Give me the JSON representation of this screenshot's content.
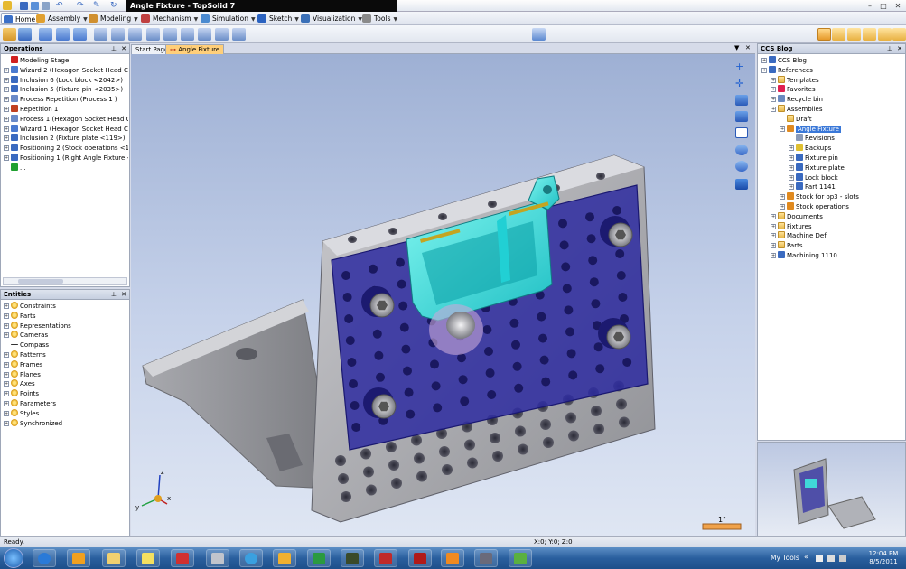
{
  "window": {
    "title": "Angle Fixture - TopSolid 7"
  },
  "menus": [
    {
      "label": "Home",
      "color": "#3a6fc8"
    },
    {
      "label": "Assembly",
      "color": "#e0a030"
    },
    {
      "label": "Modeling",
      "color": "#d09030"
    },
    {
      "label": "Mechanism",
      "color": "#c04040"
    },
    {
      "label": "Simulation",
      "color": "#4a8ad0"
    },
    {
      "label": "Sketch",
      "color": "#2a62c0"
    },
    {
      "label": "Visualization",
      "color": "#3a70b8"
    },
    {
      "label": "Tools",
      "color": "#8a8a8a"
    }
  ],
  "operations": {
    "title": "Operations",
    "items": [
      {
        "label": "Modeling Stage",
        "icon": "red-arrow-icon"
      },
      {
        "label": "Wizard 2 (Hexagon Socket Head Cap",
        "icon": "wizard-icon"
      },
      {
        "label": "Inclusion 6 (Lock block <2042>)",
        "icon": "inclusion-icon"
      },
      {
        "label": "Inclusion 5 (Fixture pin <2035>)",
        "icon": "inclusion-icon"
      },
      {
        "label": "Process Repetition (Process 1 )",
        "icon": "process-icon"
      },
      {
        "label": "Repetition 1",
        "icon": "repetition-icon"
      },
      {
        "label": "Process 1 (Hexagon Socket Head Cap",
        "icon": "process-icon"
      },
      {
        "label": "Wizard 1 (Hexagon Socket Head Cap",
        "icon": "wizard-icon"
      },
      {
        "label": "Inclusion 2 (Fixture plate <119>)",
        "icon": "inclusion-icon"
      },
      {
        "label": "Positioning 2 (Stock operations <126",
        "icon": "positioning-icon"
      },
      {
        "label": "Positioning 1 (Right Angle Fixture <1",
        "icon": "positioning-icon"
      },
      {
        "label": "...",
        "icon": "green-arrow-icon"
      }
    ]
  },
  "entities": {
    "title": "Entities",
    "items": [
      "Constraints",
      "Parts",
      "Representations",
      "Cameras",
      "Compass",
      "Patterns",
      "Frames",
      "Planes",
      "Axes",
      "Points",
      "Parameters",
      "Styles",
      "Synchronized"
    ]
  },
  "tabs": [
    {
      "label": "Start Page"
    },
    {
      "label": "Angle Fixture"
    }
  ],
  "ccs": {
    "title": "CCS Blog",
    "items": [
      {
        "label": "CCS Blog",
        "level": 0,
        "icon": "blog-icon"
      },
      {
        "label": "References",
        "level": 0,
        "icon": "references-icon"
      },
      {
        "label": "Templates",
        "level": 1,
        "icon": "folder-icon"
      },
      {
        "label": "Favorites",
        "level": 1,
        "icon": "favorites-icon"
      },
      {
        "label": "Recycle bin",
        "level": 1,
        "icon": "recycle-bin-icon"
      },
      {
        "label": "Assemblies",
        "level": 1,
        "icon": "folder-icon"
      },
      {
        "label": "Draft",
        "level": 2,
        "icon": "folder-icon"
      },
      {
        "label": "Angle Fixture",
        "level": 2,
        "icon": "assembly-icon",
        "selected": true
      },
      {
        "label": "Revisions",
        "level": 3,
        "icon": "revisions-icon"
      },
      {
        "label": "Backups",
        "level": 3,
        "icon": "backups-icon"
      },
      {
        "label": "Fixture pin",
        "level": 3,
        "icon": "part-icon"
      },
      {
        "label": "Fixture plate",
        "level": 3,
        "icon": "part-icon"
      },
      {
        "label": "Lock block",
        "level": 3,
        "icon": "part-icon"
      },
      {
        "label": "Part 1141",
        "level": 3,
        "icon": "part-icon"
      },
      {
        "label": "Stock for op3 - slots",
        "level": 2,
        "icon": "stock-icon"
      },
      {
        "label": "Stock operations",
        "level": 2,
        "icon": "stock-icon"
      },
      {
        "label": "Documents",
        "level": 1,
        "icon": "folder-icon"
      },
      {
        "label": "Fixtures",
        "level": 1,
        "icon": "folder-icon"
      },
      {
        "label": "Machine Def",
        "level": 1,
        "icon": "folder-icon"
      },
      {
        "label": "Parts",
        "level": 1,
        "icon": "folder-icon"
      },
      {
        "label": "Machining 1110",
        "level": 1,
        "icon": "machining-icon"
      }
    ]
  },
  "viewport": {
    "scale_label": "1\"",
    "triad": {
      "x": "x",
      "y": "y",
      "z": "z"
    }
  },
  "status": {
    "left": "Ready.",
    "coords": "X:0; Y:0; Z:0"
  },
  "taskbar": {
    "my_tools": "My Tools",
    "time": "12:04 PM",
    "date": "8/5/2011",
    "tray_chevron": "«"
  }
}
